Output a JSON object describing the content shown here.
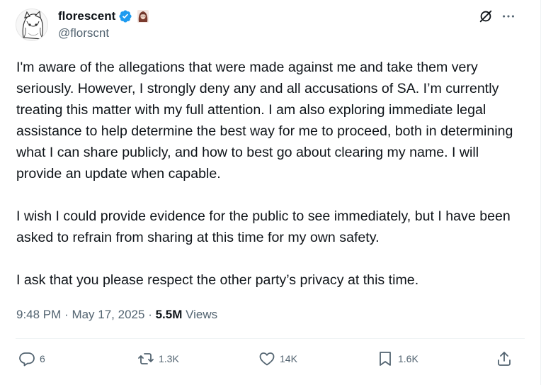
{
  "post": {
    "author": {
      "display_name": "florescent",
      "handle": "@florscnt",
      "verified_icon": "verified-badge-icon",
      "emoji_icon": "character-emoji-icon"
    },
    "body": "I'm aware of the allegations that were made against me and take them very seriously. However, I strongly deny any and all accusations of SA. I’m currently treating this matter with my full attention. I am also exploring immediate legal assistance to help determine the best way for me to proceed, both in determining what I can share publicly, and how to best go about clearing my name. I will provide an update when capable.\n\nI wish I could provide evidence for the public to see immediately, but I have been asked to refrain from sharing at this time for my own safety.\n\nI ask that you please respect the other party’s privacy at this time.",
    "meta": {
      "time": "9:48 PM",
      "date": "May 17, 2025",
      "views_count": "5.5M",
      "views_label": "Views"
    },
    "actions": {
      "replies": "6",
      "reposts": "1.3K",
      "likes": "14K",
      "bookmarks": "1.6K"
    }
  },
  "colors": {
    "text": "#0f1419",
    "secondary": "#536471",
    "verified": "#1d9bf0",
    "divider": "#eff3f4"
  }
}
